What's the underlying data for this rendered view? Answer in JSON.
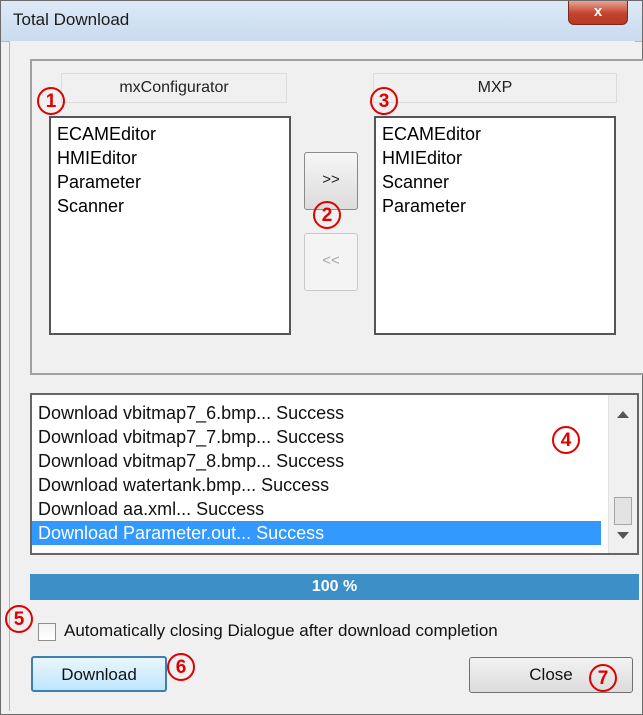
{
  "window": {
    "title": "Total Download",
    "close_glyph": "x"
  },
  "left_panel": {
    "header": "mxConfigurator",
    "items": [
      "ECAMEditor",
      "HMIEditor",
      "Parameter",
      "Scanner"
    ]
  },
  "right_panel": {
    "header": "MXP",
    "items": [
      "ECAMEditor",
      "HMIEditor",
      "Scanner",
      "Parameter"
    ]
  },
  "transfer": {
    "forward_label": ">>",
    "back_label": "<<"
  },
  "log": {
    "lines": [
      "Download vbitmap7_6.bmp... Success",
      "Download vbitmap7_7.bmp... Success",
      "Download vbitmap7_8.bmp... Success",
      "Download watertank.bmp... Success",
      "Download aa.xml... Success",
      "Download Parameter.out... Success"
    ],
    "selected_index": 5
  },
  "progress": {
    "value_percent": 100,
    "label": "100 %"
  },
  "auto_close": {
    "label": "Automatically closing Dialogue after download completion",
    "checked": false
  },
  "buttons": {
    "download": "Download",
    "close": "Close"
  },
  "callouts": [
    "1",
    "2",
    "3",
    "4",
    "5",
    "6",
    "7"
  ],
  "colors": {
    "progress": "#3c8fc7",
    "selection": "#3399ff",
    "callout": "#e00000"
  }
}
